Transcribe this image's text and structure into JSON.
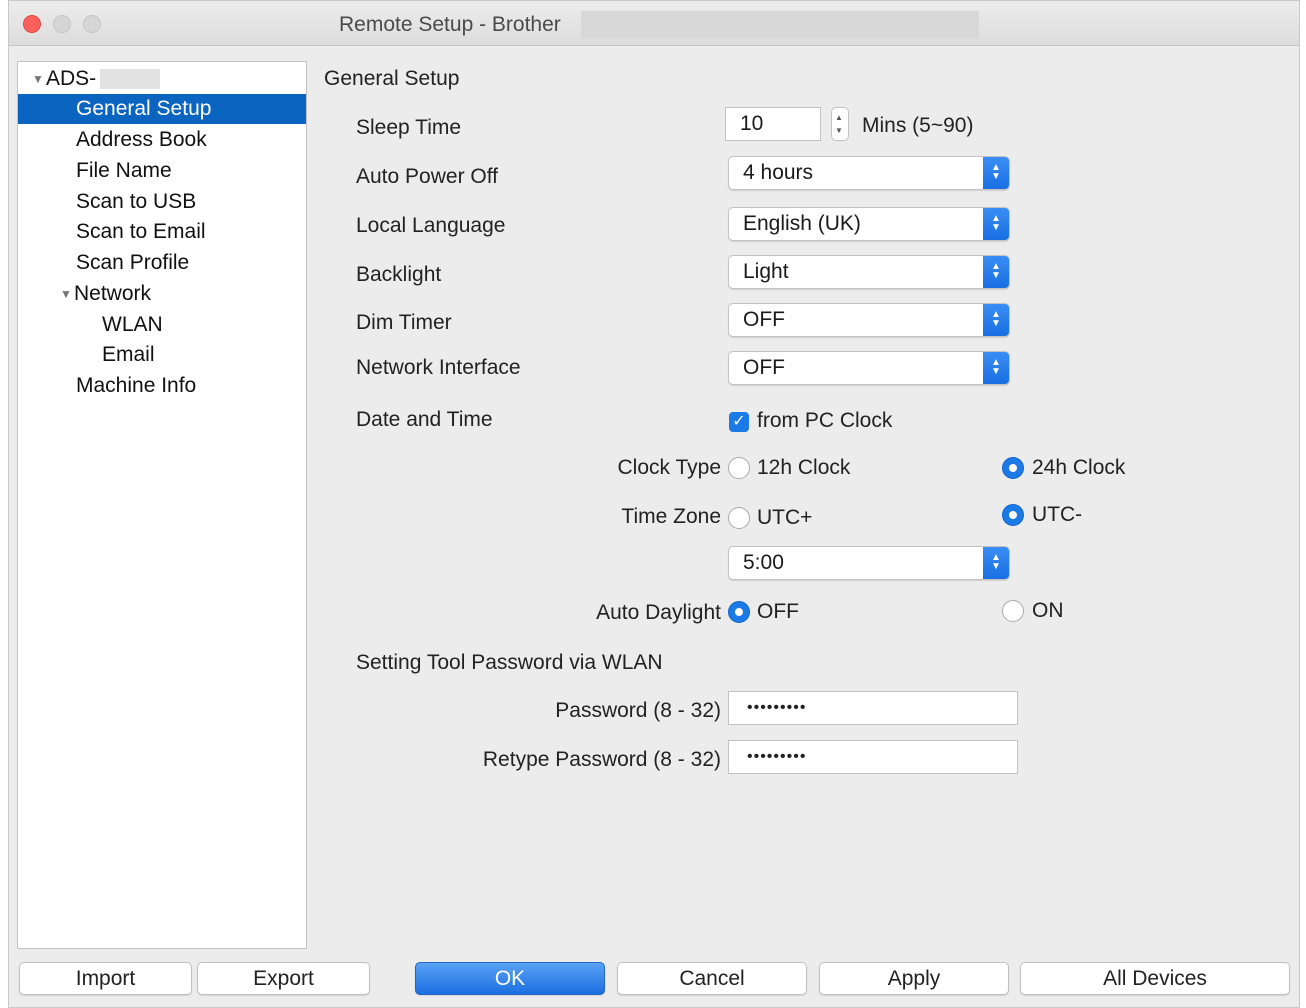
{
  "window": {
    "title": "Remote Setup - Brother"
  },
  "sidebar": {
    "root": "ADS-",
    "items": [
      {
        "label": "General Setup",
        "selected": true
      },
      {
        "label": "Address Book"
      },
      {
        "label": "File Name"
      },
      {
        "label": "Scan to USB"
      },
      {
        "label": "Scan to Email"
      },
      {
        "label": "Scan Profile"
      },
      {
        "label": "Network"
      },
      {
        "label": "WLAN"
      },
      {
        "label": "Email"
      },
      {
        "label": "Machine Info"
      }
    ]
  },
  "main": {
    "section_title": "General Setup",
    "sleep_time": {
      "label": "Sleep Time",
      "value": "10",
      "unit": "Mins (5~90)"
    },
    "auto_power_off": {
      "label": "Auto Power Off",
      "value": "4 hours"
    },
    "local_language": {
      "label": "Local Language",
      "value": "English (UK)"
    },
    "backlight": {
      "label": "Backlight",
      "value": "Light"
    },
    "dim_timer": {
      "label": "Dim Timer",
      "value": "OFF"
    },
    "network_interface": {
      "label": "Network Interface",
      "value": "OFF"
    },
    "date_time": {
      "label": "Date and Time",
      "checkbox_label": "from PC Clock",
      "checked": true
    },
    "clock_type": {
      "label": "Clock Type",
      "option1": "12h Clock",
      "option2": "24h Clock",
      "selected": "24h Clock"
    },
    "time_zone": {
      "label": "Time Zone",
      "option1": "UTC+",
      "option2": "UTC-",
      "selected": "UTC-",
      "offset": "5:00"
    },
    "auto_daylight": {
      "label": "Auto Daylight",
      "option1": "OFF",
      "option2": "ON",
      "selected": "OFF"
    },
    "password_section": "Setting Tool Password via WLAN",
    "password": {
      "label": "Password (8 - 32)",
      "masked": "•••••••••"
    },
    "retype_password": {
      "label": "Retype Password (8 - 32)",
      "masked": "•••••••••"
    }
  },
  "buttons": {
    "import": "Import",
    "export": "Export",
    "ok": "OK",
    "cancel": "Cancel",
    "apply": "Apply",
    "all_devices": "All Devices"
  },
  "colors": {
    "accent": "#1b7ae6",
    "selection": "#0b64c0",
    "close": "#fc605c"
  }
}
